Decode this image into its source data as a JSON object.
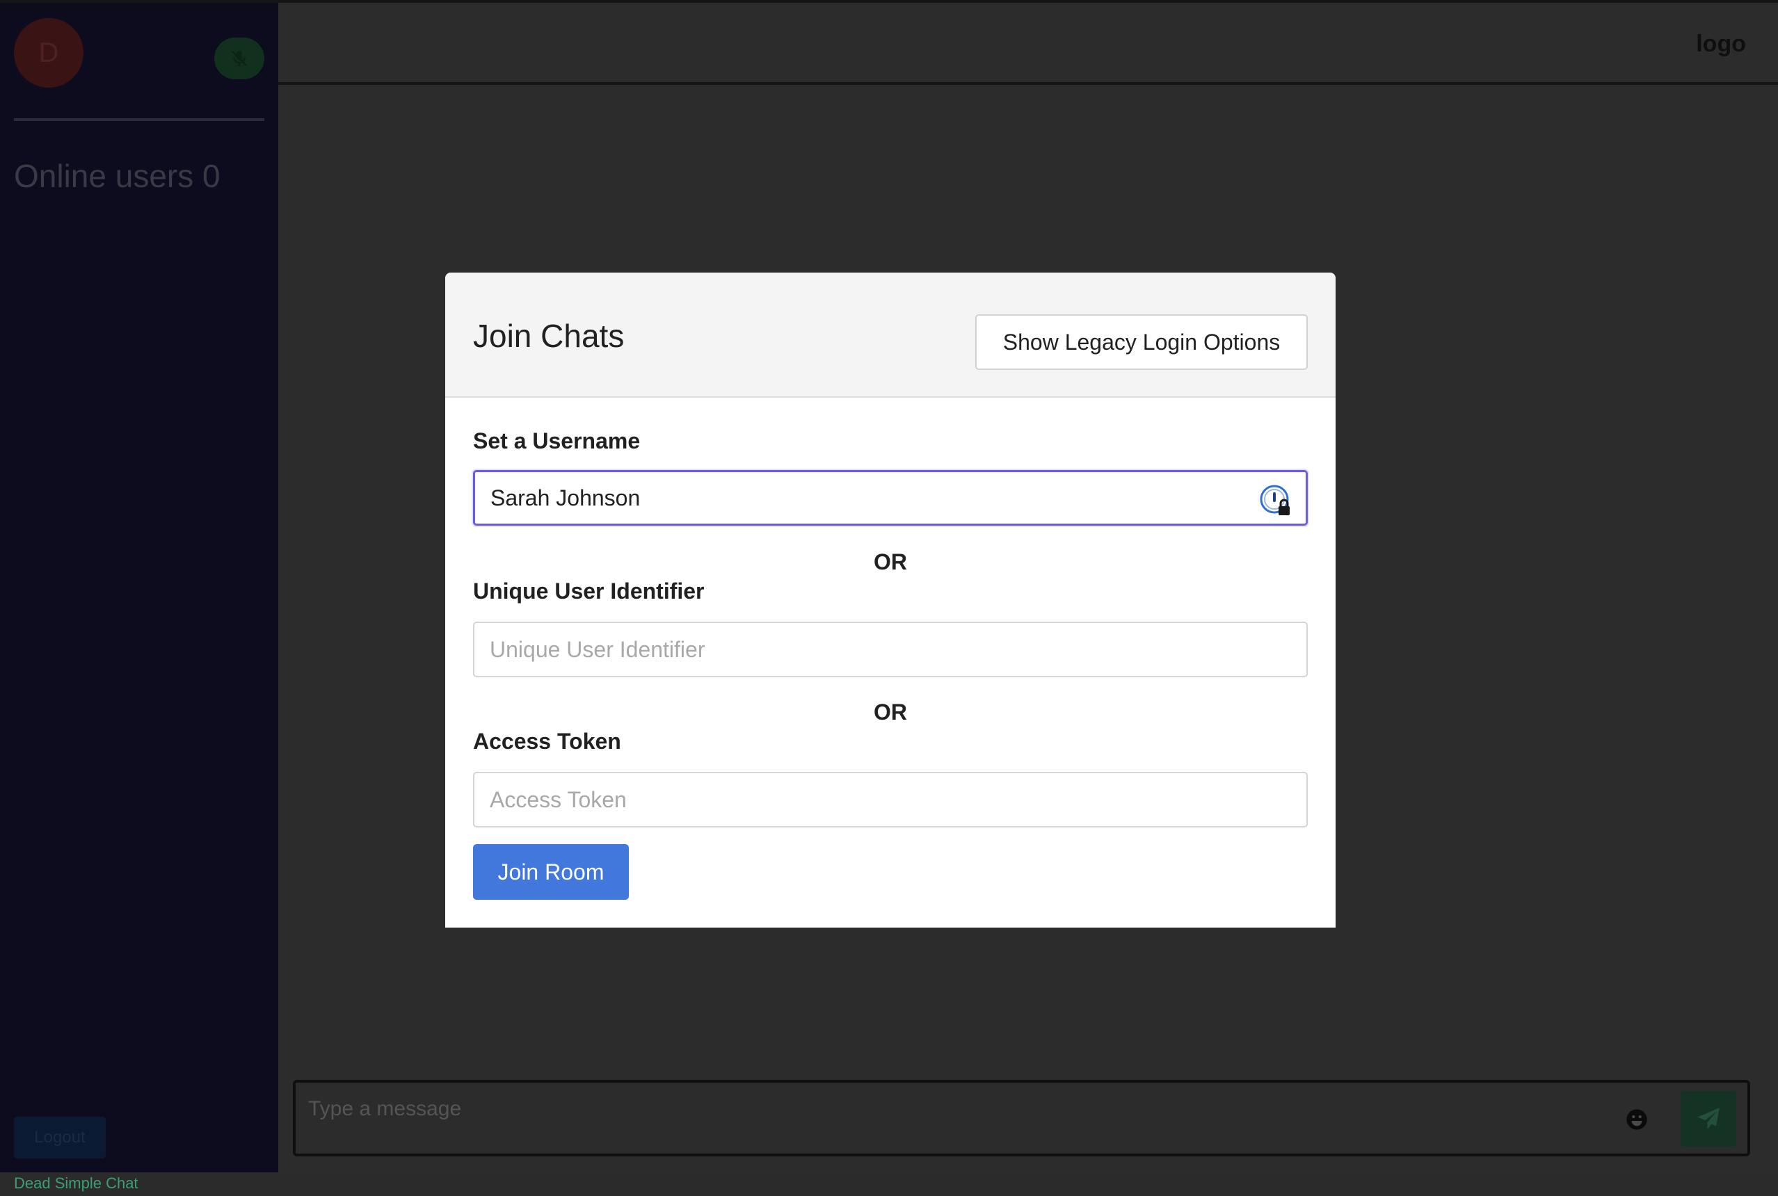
{
  "sidebar": {
    "avatar_initial": "D",
    "online_users_label": "Online users 0",
    "logout_label": "Logout",
    "mute_icon": "microphone-off-icon"
  },
  "header": {
    "logo_text": "logo"
  },
  "composer": {
    "placeholder": "Type a message",
    "emoji_icon": "emoji-icon",
    "send_icon": "send-icon"
  },
  "footer": {
    "brand_text": "Dead Simple Chat",
    "brand_color": "#3d9f73"
  },
  "modal": {
    "title": "Join Chats",
    "legacy_button_label": "Show Legacy Login Options",
    "username_label": "Set a Username",
    "username_value": "Sarah Johnson",
    "or_label": "OR",
    "uuid_label": "Unique User Identifier",
    "uuid_placeholder": "Unique User Identifier",
    "token_label": "Access Token",
    "token_placeholder": "Access Token",
    "join_button_label": "Join Room",
    "join_button_color": "#4277db",
    "focus_color": "#6b5ce7"
  }
}
